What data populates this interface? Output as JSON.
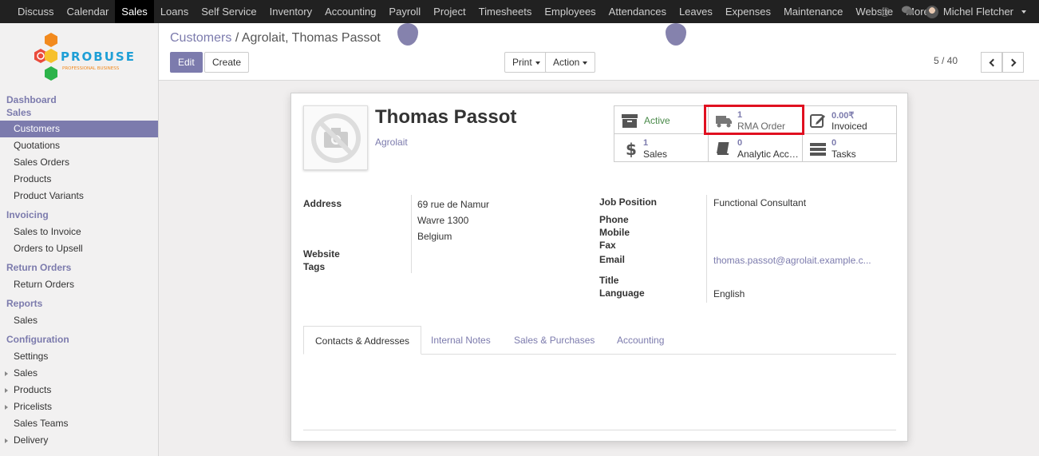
{
  "topbar": {
    "menu": [
      "Discuss",
      "Calendar",
      "Sales",
      "Loans",
      "Self Service",
      "Inventory",
      "Accounting",
      "Payroll",
      "Project",
      "Timesheets",
      "Employees",
      "Attendances",
      "Leaves",
      "Expenses",
      "Maintenance",
      "Website",
      "More"
    ],
    "active": "Sales",
    "user_name": "Michel Fletcher"
  },
  "logo": {
    "brand": "PROBUSE",
    "tagline": "PROFESSIONAL BUSINESS"
  },
  "sidebar": {
    "sections": [
      {
        "heading": "Dashboard",
        "items": []
      },
      {
        "heading": "Sales",
        "items": [
          "Customers",
          "Quotations",
          "Sales Orders",
          "Products",
          "Product Variants"
        ]
      },
      {
        "heading": "Invoicing",
        "items": [
          "Sales to Invoice",
          "Orders to Upsell"
        ]
      },
      {
        "heading": "Return Orders",
        "items": [
          "Return Orders"
        ]
      },
      {
        "heading": "Reports",
        "items": [
          "Sales"
        ]
      },
      {
        "heading": "Configuration",
        "items": [
          "Settings",
          "Sales",
          "Products",
          "Pricelists",
          "Sales Teams",
          "Delivery"
        ]
      }
    ],
    "active_item": "Customers"
  },
  "control_panel": {
    "breadcrumb_parent": "Customers",
    "breadcrumb_separator": "/",
    "breadcrumb_current": "Agrolait, Thomas Passot",
    "edit_label": "Edit",
    "create_label": "Create",
    "print_label": "Print",
    "action_label": "Action",
    "pager": "5 / 40"
  },
  "record": {
    "name": "Thomas Passot",
    "company": "Agrolait",
    "smart_buttons": {
      "active": "Active",
      "rma_count": "1",
      "rma_label": "RMA Order",
      "invoiced_amount": "0.00₹",
      "invoiced_label": "Invoiced",
      "sales_count": "1",
      "sales_label": "Sales",
      "analytic_count": "0",
      "analytic_label": "Analytic Acco...",
      "tasks_count": "0",
      "tasks_label": "Tasks"
    },
    "labels": {
      "address": "Address",
      "website": "Website",
      "tags": "Tags",
      "job_position": "Job Position",
      "phone": "Phone",
      "mobile": "Mobile",
      "fax": "Fax",
      "email": "Email",
      "title": "Title",
      "language": "Language"
    },
    "address_lines": [
      "69 rue de Namur",
      "Wavre 1300",
      "Belgium"
    ],
    "job_position": "Functional Consultant",
    "email": "thomas.passot@agrolait.example.c...",
    "language": "English"
  },
  "tabs": [
    "Contacts & Addresses",
    "Internal Notes",
    "Sales & Purchases",
    "Accounting"
  ],
  "active_tab": "Contacts & Addresses",
  "colors": {
    "accent": "#7c7bad",
    "topbar": "#212121",
    "highlight": "#e01020",
    "active_green": "#4a8a4a"
  }
}
